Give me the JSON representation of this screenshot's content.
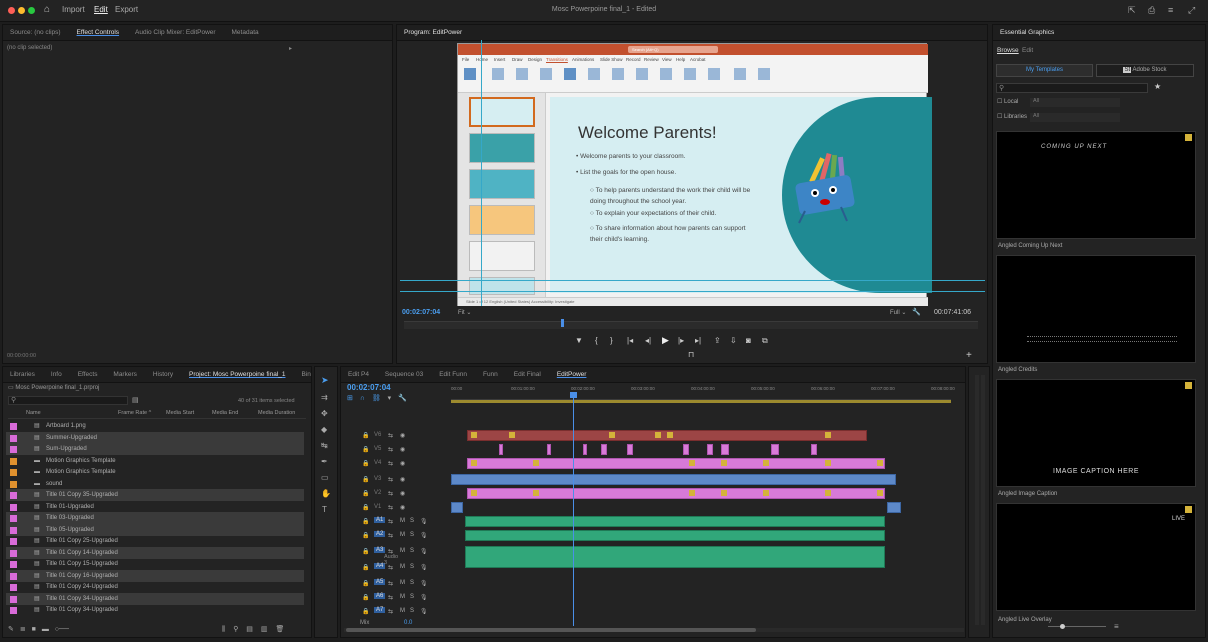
{
  "titlebar": {
    "menu": [
      "Import",
      "Edit",
      "Export"
    ],
    "document_title": "Mosc Powerpoine final_1 - Edited"
  },
  "source_panel": {
    "tabs": [
      "Source: (no clips)",
      "Effect Controls",
      "Audio Clip Mixer: EditPower",
      "Metadata"
    ],
    "empty_text": "(no clip selected)",
    "footer_timecode": "00:00:00:00"
  },
  "program_monitor": {
    "tab": "Program: EditPower",
    "timecode_current": "00:02:07:04",
    "zoom": "Fit",
    "quality": "Full",
    "timecode_total": "00:07:41:06",
    "slide": {
      "search_placeholder": "Search (Alt+Q)",
      "ribbon_tabs": [
        "File",
        "Home",
        "Insert",
        "Draw",
        "Design",
        "Transitions",
        "Animations",
        "Slide Show",
        "Record",
        "Review",
        "View",
        "Help",
        "Acrobat"
      ],
      "title": "Welcome Parents!",
      "bullets": [
        "Welcome parents to your classroom.",
        "List the goals for the open house."
      ],
      "sub_bullets": [
        "To help parents understand the work their child will be doing throughout the school year.",
        "To explain your expectations of their child.",
        "To share information about how parents can support their child's learning."
      ],
      "status_text": "Slide 1 of 12   English (United States)   Accessibility: Investigate"
    }
  },
  "essential_graphics": {
    "title": "Essential Graphics",
    "tabs": [
      "Browse",
      "Edit"
    ],
    "buttons": [
      "My Templates",
      "Adobe Stock"
    ],
    "search_placeholder": "",
    "checkboxes": [
      {
        "label": "Local",
        "value": "All"
      },
      {
        "label": "Libraries",
        "value": "All"
      }
    ],
    "templates": [
      {
        "preview_text": "COMING UP NEXT",
        "name": "Angled Coming Up Next"
      },
      {
        "preview_text": "",
        "name": "Angled Credits"
      },
      {
        "preview_text": "IMAGE CAPTION HERE",
        "name": "Angled Image Caption"
      },
      {
        "preview_text": "LIVE",
        "name": "Angled Live Overlay"
      }
    ]
  },
  "project_panel": {
    "tabs": [
      "Libraries",
      "Info",
      "Effects",
      "Markers",
      "History",
      "Project: Mosc Powerpoine final_1",
      "Bin"
    ],
    "project_file": "Mosc Powerpoine final_1.prproj",
    "search_placeholder": "",
    "item_count": "40 of 31 items selected",
    "columns": [
      "Name",
      "Frame Rate",
      "Media Start",
      "Media End",
      "Media Duration"
    ],
    "items": [
      {
        "name": "Artboard 1.png",
        "color": "pink",
        "selected": false
      },
      {
        "name": "Summer-Upgraded",
        "color": "pink",
        "selected": true
      },
      {
        "name": "Sum-Upgraded",
        "color": "pink",
        "selected": true
      },
      {
        "name": "Motion Graphics Template",
        "color": "orange",
        "selected": false
      },
      {
        "name": "Motion Graphics Template",
        "color": "orange",
        "selected": false
      },
      {
        "name": "sound",
        "color": "orange",
        "selected": false
      },
      {
        "name": "Title 01 Copy 35-Upgraded",
        "color": "pink",
        "selected": true
      },
      {
        "name": "Title 01-Upgraded",
        "color": "pink",
        "selected": false
      },
      {
        "name": "Title 03-Upgraded",
        "color": "pink",
        "selected": true
      },
      {
        "name": "Title 05-Upgraded",
        "color": "pink",
        "selected": true
      },
      {
        "name": "Title 01 Copy 25-Upgraded",
        "color": "pink",
        "selected": false
      },
      {
        "name": "Title 01 Copy 14-Upgraded",
        "color": "pink",
        "selected": true
      },
      {
        "name": "Title 01 Copy 15-Upgraded",
        "color": "pink",
        "selected": false
      },
      {
        "name": "Title 01 Copy 16-Upgraded",
        "color": "pink",
        "selected": true
      },
      {
        "name": "Title 01 Copy 24-Upgraded",
        "color": "pink",
        "selected": false
      },
      {
        "name": "Title 01 Copy 34-Upgraded",
        "color": "pink",
        "selected": true
      },
      {
        "name": "Title 01 Copy 34-Upgraded",
        "color": "pink",
        "selected": false
      }
    ]
  },
  "timeline": {
    "tabs": [
      "Edit P4",
      "Sequence 03",
      "Edit Funn",
      "Funn",
      "Edit Final",
      "EditPower"
    ],
    "timecode": "00:02:07:04",
    "ruler": [
      "00:00",
      "00:01:00:00",
      "00:02:00:00",
      "00:03:00:00",
      "00:04:00:00",
      "00:05:00:00",
      "00:06:00:00",
      "00:07:00:00",
      "00:08:00:00"
    ],
    "video_tracks": [
      "V6",
      "V5",
      "V4",
      "V3",
      "V2",
      "V1"
    ],
    "audio_tracks": [
      "A1",
      "A2",
      "A3",
      "A4",
      "A5",
      "A6",
      "A7"
    ],
    "audio3_name": "Audio 3",
    "mix_label": "Mix",
    "mix_value": "0.0"
  }
}
